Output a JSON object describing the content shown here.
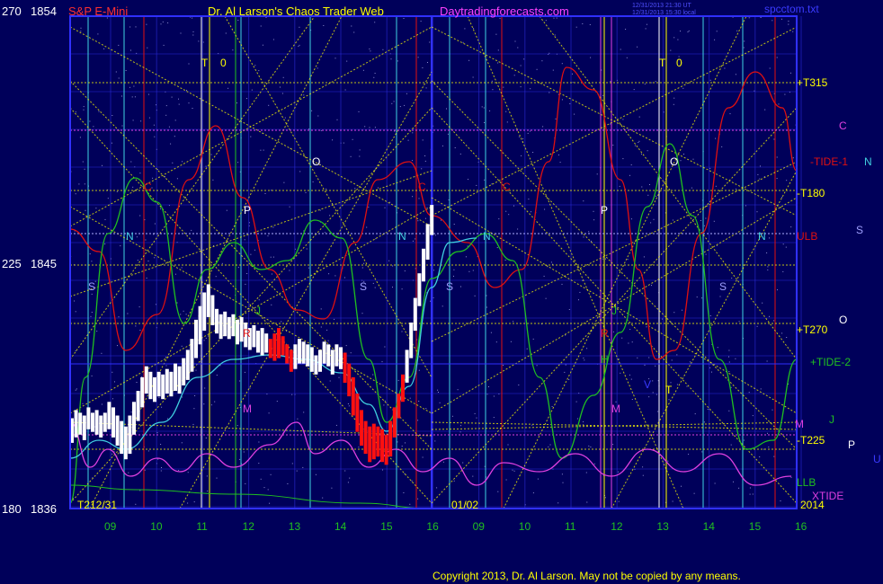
{
  "header": {
    "price_top_left": "270",
    "price_top_right": "1854",
    "symbol": "S&P E-Mini",
    "app_title": "Dr. Al Larson's Chaos Trader Web",
    "site": "Daytradingforecasts.com",
    "stamp_line1": "12/31/2013 21:30 UT",
    "stamp_line2": "12/31/2013 15:30 local",
    "file": "spcctom.txt"
  },
  "copyright": "Copyright 2013, Dr. Al Larson. May not be copied by any means.",
  "colors": {
    "background": "#00005a",
    "grid_blue": "#2a2ad8",
    "frame_blue": "#3030ff",
    "yellow": "#ffff00",
    "red": "#e01010",
    "green": "#20c020",
    "cyan": "#40d0e0",
    "magenta": "#e040e0",
    "white": "#ffffff"
  },
  "chart_data": {
    "type": "bar",
    "y_axis_labels": [
      {
        "angle": "270",
        "price": "1854"
      },
      {
        "angle": "225",
        "price": "1845"
      },
      {
        "angle": "180",
        "price": "1836"
      }
    ],
    "ylim": [
      1836,
      1854
    ],
    "x_ticks": [
      "09",
      "10",
      "11",
      "12",
      "13",
      "14",
      "15",
      "16",
      "09",
      "10",
      "11",
      "12",
      "13",
      "14",
      "15",
      "16"
    ],
    "date_marks": [
      {
        "id": "start",
        "text": "12/31"
      },
      {
        "id": "mid",
        "text": "01/02"
      },
      {
        "id": "end",
        "text": "2014"
      }
    ],
    "planet_glyphs": {
      "T1": "T",
      "zero1": "0",
      "T2": "T",
      "zero2": "0",
      "C1": "C",
      "C2": "C",
      "C3": "C",
      "N1": "N",
      "N2": "N",
      "N3": "N",
      "N4": "N",
      "O1": "O",
      "O2": "O",
      "P1": "P",
      "P2": "P",
      "S1": "S",
      "S2": "S",
      "S3": "S",
      "S4": "S",
      "J1": "J",
      "J2": "J",
      "M1": "M",
      "M2": "M",
      "R1": "R",
      "R2": "R",
      "H1": "H",
      "V1": "V",
      "T3": "T",
      "right_C": "C",
      "right_N": "N",
      "right_S": "S",
      "right_O": "O",
      "right_P": "P",
      "right_U": "U"
    },
    "right_labels": [
      {
        "id": "t315",
        "text": "+T315"
      },
      {
        "id": "tide1",
        "text": "-TIDE-1"
      },
      {
        "id": "t180",
        "text": "-T180"
      },
      {
        "id": "ulb",
        "text": "ULB"
      },
      {
        "id": "t270",
        "text": "+T270"
      },
      {
        "id": "tide2",
        "text": "+TIDE-2"
      },
      {
        "id": "m",
        "text": "M"
      },
      {
        "id": "j",
        "text": "J"
      },
      {
        "id": "t225",
        "text": "-T225"
      },
      {
        "id": "llb",
        "text": "LLB"
      },
      {
        "id": "xtide",
        "text": "XTIDE"
      }
    ],
    "bars_day1": [
      {
        "t": 0.0,
        "h": 1839.3,
        "l": 1838.4
      },
      {
        "t": 0.5,
        "h": 1839.6,
        "l": 1838.6
      },
      {
        "t": 1.0,
        "h": 1839.5,
        "l": 1838.7
      },
      {
        "t": 1.5,
        "h": 1839.4,
        "l": 1838.5
      },
      {
        "t": 2.0,
        "h": 1839.7,
        "l": 1838.9
      },
      {
        "t": 2.5,
        "h": 1839.5,
        "l": 1838.8
      },
      {
        "t": 3.0,
        "h": 1839.6,
        "l": 1838.7
      },
      {
        "t": 3.5,
        "h": 1839.4,
        "l": 1838.6
      },
      {
        "t": 4.0,
        "h": 1839.5,
        "l": 1838.8
      },
      {
        "t": 4.5,
        "h": 1839.9,
        "l": 1838.9
      },
      {
        "t": 5.0,
        "h": 1839.7,
        "l": 1838.6
      },
      {
        "t": 5.5,
        "h": 1839.4,
        "l": 1838.3
      },
      {
        "t": 6.0,
        "h": 1839.2,
        "l": 1838.0
      },
      {
        "t": 6.5,
        "h": 1839.0,
        "l": 1837.8
      },
      {
        "t": 7.0,
        "h": 1839.4,
        "l": 1838.0
      },
      {
        "t": 7.5,
        "h": 1839.9,
        "l": 1838.7
      },
      {
        "t": 8.0,
        "h": 1840.3,
        "l": 1839.2
      },
      {
        "t": 8.5,
        "h": 1840.8,
        "l": 1839.7
      },
      {
        "t": 9.0,
        "h": 1841.2,
        "l": 1840.2
      },
      {
        "t": 9.5,
        "h": 1841.0,
        "l": 1840.0
      },
      {
        "t": 10.0,
        "h": 1840.8,
        "l": 1839.9
      },
      {
        "t": 10.5,
        "h": 1841.0,
        "l": 1840.1
      },
      {
        "t": 11.0,
        "h": 1840.9,
        "l": 1840.0
      },
      {
        "t": 11.5,
        "h": 1841.1,
        "l": 1840.2
      },
      {
        "t": 12.0,
        "h": 1841.0,
        "l": 1840.1
      },
      {
        "t": 12.5,
        "h": 1841.3,
        "l": 1840.3
      },
      {
        "t": 13.0,
        "h": 1841.2,
        "l": 1840.2
      },
      {
        "t": 13.5,
        "h": 1841.5,
        "l": 1840.5
      },
      {
        "t": 14.0,
        "h": 1841.8,
        "l": 1840.7
      },
      {
        "t": 14.5,
        "h": 1842.2,
        "l": 1841.0
      },
      {
        "t": 15.0,
        "h": 1842.9,
        "l": 1841.5
      },
      {
        "t": 15.5,
        "h": 1843.4,
        "l": 1842.0
      },
      {
        "t": 16.0,
        "h": 1843.9,
        "l": 1842.5
      },
      {
        "t": 16.5,
        "h": 1844.2,
        "l": 1843.0
      },
      {
        "t": 17.0,
        "h": 1843.8,
        "l": 1842.7
      },
      {
        "t": 17.5,
        "h": 1843.3,
        "l": 1842.4
      },
      {
        "t": 18.0,
        "h": 1843.1,
        "l": 1842.2
      },
      {
        "t": 18.5,
        "h": 1843.2,
        "l": 1842.3
      },
      {
        "t": 19.0,
        "h": 1843.0,
        "l": 1842.2
      },
      {
        "t": 19.5,
        "h": 1843.1,
        "l": 1842.3
      },
      {
        "t": 20.0,
        "h": 1842.9,
        "l": 1842.0
      },
      {
        "t": 20.5,
        "h": 1843.0,
        "l": 1842.1
      },
      {
        "t": 21.0,
        "h": 1842.8,
        "l": 1841.9
      },
      {
        "t": 21.5,
        "h": 1842.6,
        "l": 1841.8
      },
      {
        "t": 22.0,
        "h": 1842.7,
        "l": 1841.9
      },
      {
        "t": 22.5,
        "h": 1842.5,
        "l": 1841.7
      },
      {
        "t": 23.0,
        "h": 1842.6,
        "l": 1841.6
      },
      {
        "t": 23.5,
        "h": 1842.4,
        "l": 1841.7
      },
      {
        "t": 24.0,
        "h": 1842.2,
        "l": 1841.5
      },
      {
        "t": 24.5,
        "h": 1842.4,
        "l": 1841.4
      },
      {
        "t": 25.0,
        "h": 1842.6,
        "l": 1841.5
      },
      {
        "t": 25.5,
        "h": 1842.3,
        "l": 1841.6
      },
      {
        "t": 26.0,
        "h": 1842.0,
        "l": 1841.3
      },
      {
        "t": 26.5,
        "h": 1841.8,
        "l": 1841.0
      },
      {
        "t": 27.0,
        "h": 1842.0,
        "l": 1841.1
      },
      {
        "t": 27.5,
        "h": 1842.2,
        "l": 1841.3
      },
      {
        "t": 28.0,
        "h": 1842.1,
        "l": 1841.3
      },
      {
        "t": 28.5,
        "h": 1842.0,
        "l": 1841.2
      },
      {
        "t": 29.0,
        "h": 1841.9,
        "l": 1841.0
      },
      {
        "t": 29.5,
        "h": 1841.6,
        "l": 1840.9
      },
      {
        "t": 30.0,
        "h": 1841.8,
        "l": 1841.0
      },
      {
        "t": 30.5,
        "h": 1842.1,
        "l": 1841.3
      },
      {
        "t": 31.0,
        "h": 1842.0,
        "l": 1841.2
      },
      {
        "t": 31.5,
        "h": 1841.8,
        "l": 1840.9
      },
      {
        "t": 32.0,
        "h": 1842.0,
        "l": 1841.2
      },
      {
        "t": 32.5,
        "h": 1841.9,
        "l": 1841.1
      },
      {
        "t": 33.0,
        "h": 1841.7,
        "l": 1840.6
      },
      {
        "t": 33.5,
        "h": 1841.3,
        "l": 1840.1
      },
      {
        "t": 34.0,
        "h": 1840.8,
        "l": 1839.4
      },
      {
        "t": 34.5,
        "h": 1840.2,
        "l": 1838.8
      },
      {
        "t": 35.0,
        "h": 1839.6,
        "l": 1838.3
      },
      {
        "t": 35.5,
        "h": 1839.2,
        "l": 1838.0
      },
      {
        "t": 36.0,
        "h": 1839.0,
        "l": 1837.7
      },
      {
        "t": 36.5,
        "h": 1839.1,
        "l": 1837.8
      },
      {
        "t": 37.0,
        "h": 1839.0,
        "l": 1837.9
      },
      {
        "t": 37.5,
        "h": 1838.9,
        "l": 1837.7
      },
      {
        "t": 38.0,
        "h": 1838.7,
        "l": 1837.6
      },
      {
        "t": 38.5,
        "h": 1839.2,
        "l": 1837.9
      },
      {
        "t": 39.0,
        "h": 1839.7,
        "l": 1838.6
      },
      {
        "t": 39.5,
        "h": 1840.2,
        "l": 1839.3
      },
      {
        "t": 40.0,
        "h": 1840.9,
        "l": 1839.9
      },
      {
        "t": 40.5,
        "h": 1841.8,
        "l": 1840.6
      },
      {
        "t": 41.0,
        "h": 1842.8,
        "l": 1841.5
      },
      {
        "t": 41.5,
        "h": 1843.7,
        "l": 1842.5
      },
      {
        "t": 42.0,
        "h": 1844.6,
        "l": 1843.4
      },
      {
        "t": 42.5,
        "h": 1845.5,
        "l": 1844.3
      },
      {
        "t": 43.0,
        "h": 1846.4,
        "l": 1845.1
      },
      {
        "t": 43.5,
        "h": 1847.1,
        "l": 1846.0
      }
    ],
    "red_bar_index_ranges": [
      [
        48,
        53
      ],
      [
        66,
        80
      ]
    ]
  }
}
